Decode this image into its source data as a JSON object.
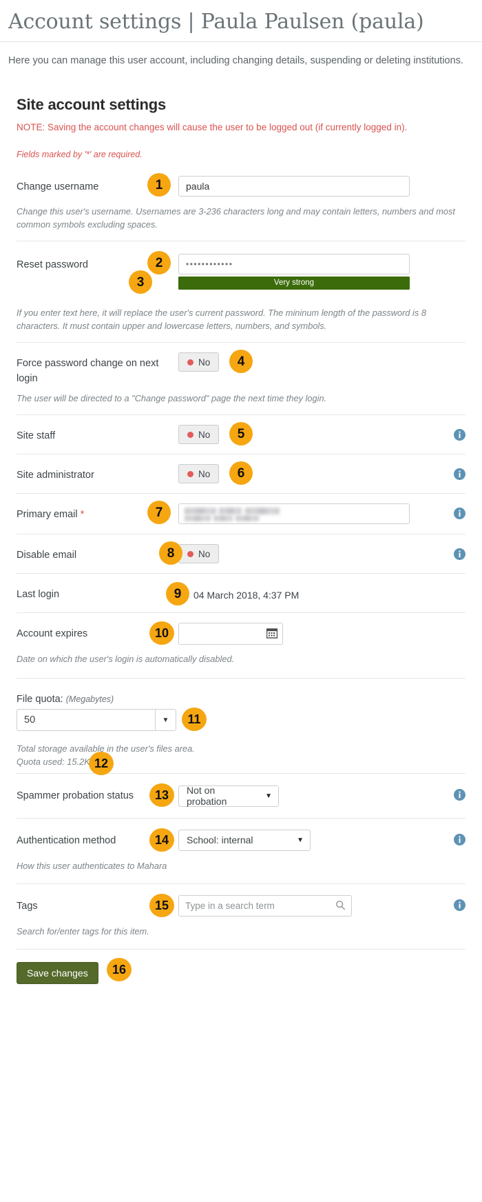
{
  "header": {
    "title": "Account settings | Paula Paulsen (paula)",
    "intro": "Here you can manage this user account, including changing details, suspending or deleting institutions."
  },
  "panel": {
    "title": "Site account settings",
    "note": "NOTE: Saving the account changes will cause the user to be logged out (if currently logged in).",
    "required_note": "Fields marked by '*' are required."
  },
  "fields": {
    "username": {
      "label": "Change username",
      "value": "paula",
      "help": "Change this user's username. Usernames are 3-236 characters long and may contain letters, numbers and most common symbols excluding spaces."
    },
    "password": {
      "label": "Reset password",
      "value": "••••••••••••",
      "strength": "Very strong",
      "strength_color": "#3b6b0a",
      "help": "If you enter text here, it will replace the user's current password. The mininum length of the password is 8 characters. It must contain upper and lowercase letters, numbers, and symbols."
    },
    "force_password_change": {
      "label": "Force password change on next login",
      "toggle": "No",
      "help": "The user will be directed to a \"Change password\" page the next time they login."
    },
    "site_staff": {
      "label": "Site staff",
      "toggle": "No"
    },
    "site_administrator": {
      "label": "Site administrator",
      "toggle": "No"
    },
    "primary_email": {
      "label": "Primary email",
      "required_marker": "*",
      "value": ""
    },
    "disable_email": {
      "label": "Disable email",
      "toggle": "No"
    },
    "last_login": {
      "label": "Last login",
      "value": "04 March 2018, 4:37 PM"
    },
    "account_expires": {
      "label": "Account expires",
      "value": "",
      "help": "Date on which the user's login is automatically disabled."
    },
    "file_quota": {
      "label": "File quota:",
      "unit": "(Megabytes)",
      "value": "50",
      "help": "Total storage available in the user's files area.",
      "quota_used": "Quota used: 15.2KB"
    },
    "spammer_probation": {
      "label": "Spammer probation status",
      "value": "Not on probation"
    },
    "authentication_method": {
      "label": "Authentication method",
      "value": "School: internal",
      "help": "How this user authenticates to Mahara"
    },
    "tags": {
      "label": "Tags",
      "placeholder": "Type in a search term",
      "value": "",
      "help": "Search for/enter tags for this item."
    }
  },
  "actions": {
    "save": "Save changes"
  },
  "icons": {
    "info": "info-icon",
    "calendar": "calendar-icon",
    "search": "search-icon",
    "caret": "▼"
  },
  "colors": {
    "badge": "#f5a611",
    "note": "#d9534f",
    "save_button": "#54692a",
    "strength_bar": "#3b6b0a",
    "info_icon": "#5e92b5",
    "toggle_dot": "#e35b5b"
  },
  "annotations": [
    {
      "n": "1"
    },
    {
      "n": "2"
    },
    {
      "n": "3"
    },
    {
      "n": "4"
    },
    {
      "n": "5"
    },
    {
      "n": "6"
    },
    {
      "n": "7"
    },
    {
      "n": "8"
    },
    {
      "n": "9"
    },
    {
      "n": "10"
    },
    {
      "n": "11"
    },
    {
      "n": "12"
    },
    {
      "n": "13"
    },
    {
      "n": "14"
    },
    {
      "n": "15"
    },
    {
      "n": "16"
    }
  ]
}
